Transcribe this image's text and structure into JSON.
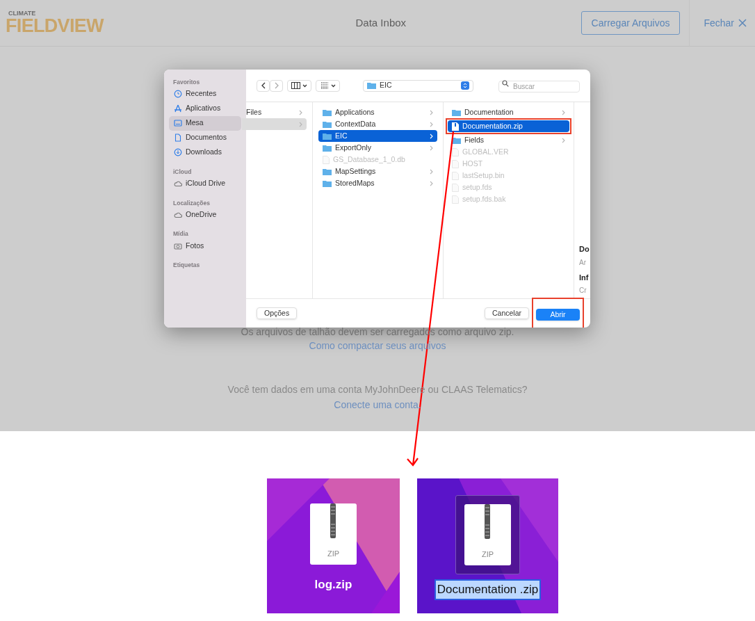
{
  "header": {
    "logo_top": "CLIMATE",
    "logo_main": "FIELDVIEW",
    "title": "Data Inbox",
    "upload_button": "Carregar Arquivos",
    "close_button": "Fechar"
  },
  "page": {
    "note": "Os arquivos de talhão devem ser carregados como arquivo zip.",
    "note_link": "Como compactar seus arquivos",
    "question": "Você tem dados em uma conta MyJohnDeere ou CLAAS Telematics?",
    "question_link": "Conecte uma conta."
  },
  "dialog": {
    "sidebar": [
      {
        "heading": "Favoritos",
        "items": [
          {
            "label": "Recentes",
            "kind": "recent",
            "selected": false
          },
          {
            "label": "Aplicativos",
            "kind": "apps",
            "selected": false
          },
          {
            "label": "Mesa",
            "kind": "desktop",
            "selected": true
          },
          {
            "label": "Documentos",
            "kind": "documents",
            "selected": false
          },
          {
            "label": "Downloads",
            "kind": "downloads",
            "selected": false
          }
        ]
      },
      {
        "heading": "iCloud",
        "items": [
          {
            "label": "iCloud Drive",
            "kind": "cloud",
            "selected": false
          }
        ]
      },
      {
        "heading": "Localizações",
        "items": [
          {
            "label": "OneDrive",
            "kind": "cloud",
            "selected": false
          }
        ]
      },
      {
        "heading": "Mídia",
        "items": [
          {
            "label": "Fotos",
            "kind": "photos",
            "selected": false
          }
        ]
      },
      {
        "heading": "Etiquetas"
      }
    ],
    "location": "EIC",
    "search": {
      "placeholder": "Buscar"
    },
    "columns": [
      {
        "active": false,
        "items": [
          {
            "label": "Files",
            "kind": "cut",
            "selected": false
          },
          {
            "kind": "cut",
            "selected": true
          }
        ]
      },
      {
        "active": true,
        "items": [
          {
            "label": "Applications",
            "kind": "folder",
            "selected": false,
            "disabled": false
          },
          {
            "label": "ContextData",
            "kind": "folder",
            "selected": false,
            "disabled": false
          },
          {
            "label": "EIC",
            "kind": "folder",
            "selected": true,
            "disabled": false
          },
          {
            "label": "ExportOnly",
            "kind": "folder",
            "selected": false,
            "disabled": false
          },
          {
            "label": "GS_Database_1_0.db",
            "kind": "file",
            "selected": false,
            "disabled": true
          },
          {
            "label": "MapSettings",
            "kind": "folder",
            "selected": false,
            "disabled": false
          },
          {
            "label": "StoredMaps",
            "kind": "folder",
            "selected": false,
            "disabled": false
          }
        ]
      },
      {
        "active": true,
        "items": [
          {
            "label": "Documentation",
            "kind": "folder",
            "selected": false,
            "disabled": false,
            "outlined": false
          },
          {
            "label": "Documentation.zip",
            "kind": "zip",
            "selected": true,
            "disabled": false,
            "outlined": true
          },
          {
            "label": "Fields",
            "kind": "folder",
            "selected": false,
            "disabled": false,
            "outlined": false
          },
          {
            "label": "GLOBAL.VER",
            "kind": "file",
            "selected": false,
            "disabled": true,
            "outlined": false
          },
          {
            "label": "HOST",
            "kind": "file",
            "selected": false,
            "disabled": true,
            "outlined": false
          },
          {
            "label": "lastSetup.bin",
            "kind": "file",
            "selected": false,
            "disabled": true,
            "outlined": false
          },
          {
            "label": "setup.fds",
            "kind": "file",
            "selected": false,
            "disabled": true,
            "outlined": false
          },
          {
            "label": "setup.fds.bak",
            "kind": "file",
            "selected": false,
            "disabled": true,
            "outlined": false
          }
        ]
      }
    ],
    "preview": [
      {
        "text": "Do",
        "kind": "title"
      },
      {
        "text": "Ar",
        "kind": "meta"
      },
      {
        "text": "Inf",
        "kind": "title"
      },
      {
        "text": "Cr",
        "kind": "meta"
      }
    ],
    "options_button": "Opções",
    "buttons": [
      {
        "label": "Cancelar",
        "kind": "cancel",
        "outlined": false
      },
      {
        "label": "Abrir",
        "kind": "default",
        "outlined": true
      }
    ]
  },
  "desktop_shots": [
    {
      "label": "log.zip",
      "icon_text": "ZIP",
      "selected": false
    },
    {
      "label": "Documentation .zip",
      "icon_text": "ZIP",
      "selected": true
    }
  ]
}
